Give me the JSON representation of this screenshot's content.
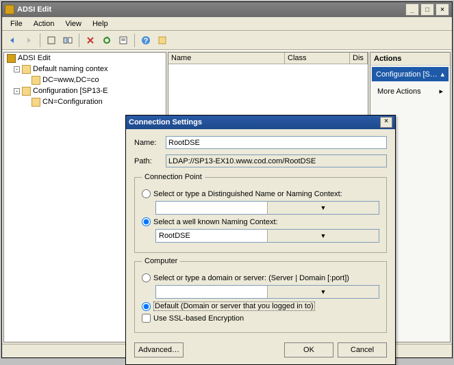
{
  "window": {
    "title": "ADSI Edit"
  },
  "menu": {
    "file": "File",
    "action": "Action",
    "view": "View",
    "help": "Help"
  },
  "tree": {
    "root": "ADSI Edit",
    "n1": "Default naming contex",
    "n1a": "DC=www,DC=co",
    "n2": "Configuration [SP13-E",
    "n2a": "CN=Configuration"
  },
  "list": {
    "col1": "Name",
    "col2": "Class",
    "col3": "Dis"
  },
  "actions": {
    "header": "Actions",
    "selected": "Configuration [S…",
    "more": "More Actions"
  },
  "dialog": {
    "title": "Connection Settings",
    "name_label": "Name:",
    "name_value": "RootDSE",
    "path_label": "Path:",
    "path_value": "LDAP://SP13-EX10.www.cod.com/RootDSE",
    "cp_legend": "Connection Point",
    "cp_opt1": "Select or type a Distinguished Name or Naming Context:",
    "cp_opt2": "Select a well known Naming Context:",
    "cp_combo": "RootDSE",
    "comp_legend": "Computer",
    "comp_opt1": "Select or type a domain or server: (Server | Domain [:port])",
    "comp_opt2": "Default (Domain or server that you logged in to)",
    "ssl": "Use SSL-based Encryption",
    "advanced": "Advanced…",
    "ok": "OK",
    "cancel": "Cancel"
  }
}
